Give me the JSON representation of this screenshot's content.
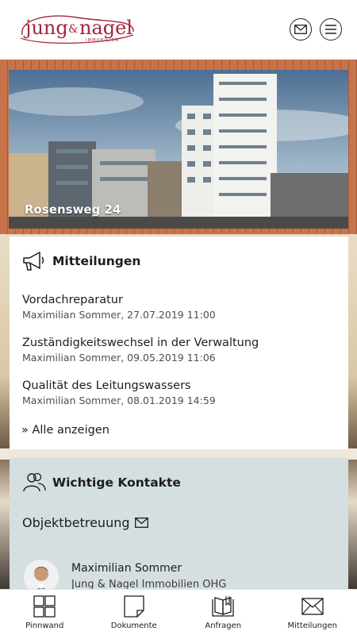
{
  "header": {
    "logo_text": "jung&nagel",
    "logo_subtext": "IMMOBILIEN",
    "icons": [
      "mail-icon",
      "menu-icon"
    ]
  },
  "hero": {
    "title": "Rosensweg 24"
  },
  "messages": {
    "title": "Mitteilungen",
    "icon": "megaphone-icon",
    "items": [
      {
        "title": "Vordachreparatur",
        "meta": "Maximilian Sommer, 27.07.2019 11:00"
      },
      {
        "title": "Zuständigkeitswechsel in der Verwaltung",
        "meta": "Maximilian Sommer, 09.05.2019 11:06"
      },
      {
        "title": "Qualität des Leitungswassers",
        "meta": "Maximilian Sommer, 08.01.2019 14:59"
      }
    ],
    "show_all": "» Alle anzeigen"
  },
  "contacts": {
    "title": "Wichtige Kontakte",
    "icon": "people-icon",
    "section": "Objektbetreuung",
    "person": {
      "name": "Maximilian Sommer",
      "company": "Jung & Nagel Immobilien OHG"
    }
  },
  "nav": [
    {
      "label": "Pinnwand",
      "icon": "grid-icon"
    },
    {
      "label": "Dokumente",
      "icon": "document-icon"
    },
    {
      "label": "Anfragen",
      "icon": "book-icon"
    },
    {
      "label": "Mitteilungen",
      "icon": "envelope-icon"
    }
  ],
  "colors": {
    "brand": "#a4243b",
    "contact_card": "#d6dfe0",
    "text": "#1d1d1d"
  }
}
